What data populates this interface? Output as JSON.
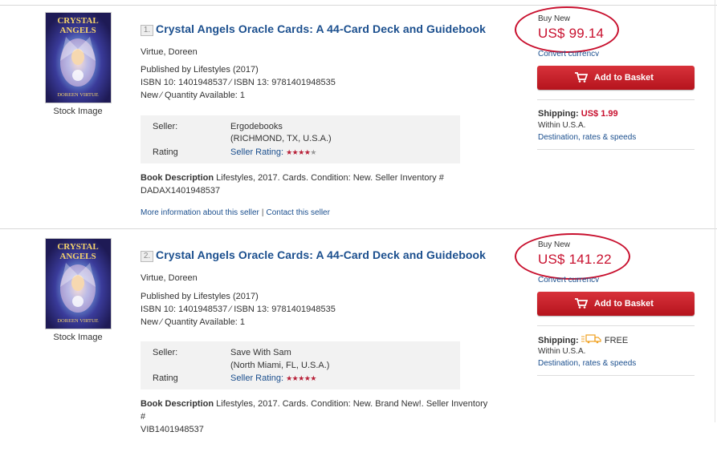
{
  "listings": [
    {
      "number": "1.",
      "title": "Crystal Angels Oracle Cards: A 44-Card Deck and Guidebook",
      "author": "Virtue, Doreen",
      "published": "Published by Lifestyles (2017)",
      "isbn": "ISBN 10: 1401948537 ⁄ ISBN 13: 9781401948535",
      "quantity": "New ⁄ Quantity Available: 1",
      "stock_label": "Stock Image",
      "seller_label": "Seller:",
      "seller_name": "Ergodebooks",
      "seller_location": "(RICHMOND, TX, U.S.A.)",
      "rating_label": "Rating",
      "seller_rating_label": "Seller Rating:",
      "rating_stars": 4,
      "description_label": "Book Description",
      "description": "Lifestyles, 2017. Cards. Condition: New. Seller Inventory #",
      "inventory": "DADAX1401948537",
      "more_info_link": "More information about this seller",
      "contact_link": "Contact this seller",
      "buy_label": "Buy New",
      "price": "US$ 99.14",
      "convert_link": "Convert currency",
      "basket_label": "Add to Basket",
      "shipping_label": "Shipping:",
      "shipping_cost": "US$ 1.99",
      "shipping_region": "Within U.S.A.",
      "destination_link": "Destination, rates & speeds"
    },
    {
      "number": "2.",
      "title": "Crystal Angels Oracle Cards: A 44-Card Deck and Guidebook",
      "author": "Virtue, Doreen",
      "published": "Published by Lifestyles (2017)",
      "isbn": "ISBN 10: 1401948537 ⁄ ISBN 13: 9781401948535",
      "quantity": "New ⁄ Quantity Available: 1",
      "stock_label": "Stock Image",
      "seller_label": "Seller:",
      "seller_name": "Save With Sam",
      "seller_location": "(North Miami, FL, U.S.A.)",
      "rating_label": "Rating",
      "seller_rating_label": "Seller Rating:",
      "rating_stars": 5,
      "description_label": "Book Description",
      "description": "Lifestyles, 2017. Cards. Condition: New. Brand New!. Seller Inventory #",
      "inventory": "VIB1401948537",
      "buy_label": "Buy New",
      "price": "US$ 141.22",
      "convert_link": "Convert currency",
      "basket_label": "Add to Basket",
      "shipping_label": "Shipping:",
      "shipping_cost": "FREE",
      "shipping_region": "Within U.S.A.",
      "destination_link": "Destination, rates & speeds"
    }
  ],
  "cover_text": {
    "line1": "CRYSTAL",
    "line2": "ANGELS",
    "line3": "DOREEN VIRTUE"
  },
  "colors": {
    "price_red": "#c8102e",
    "link_blue": "#1b4f8e",
    "button_red": "#c8202a"
  },
  "icons": {
    "basket": "shopping-cart-icon",
    "free_shipping": "truck-icon"
  }
}
